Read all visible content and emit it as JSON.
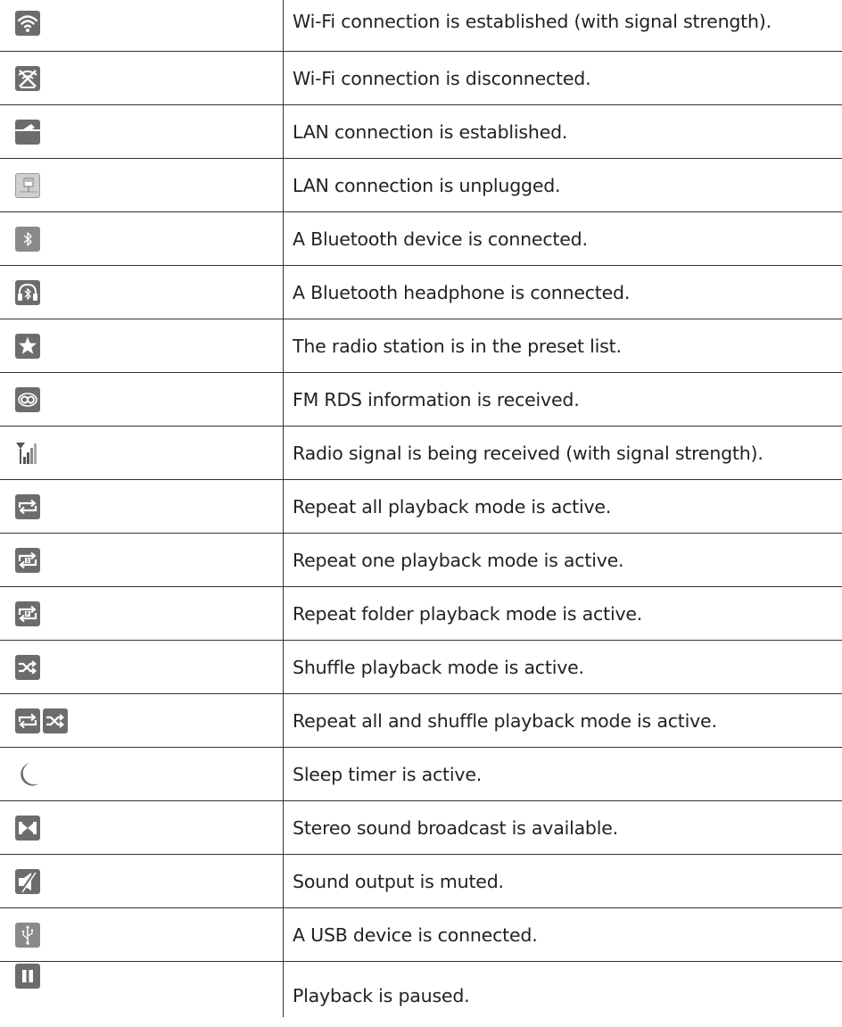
{
  "rows": [
    {
      "icons": [
        "wifi-signal-icon"
      ],
      "text": "Wi-Fi connection is established (with signal strength)."
    },
    {
      "icons": [
        "wifi-disconnected-icon"
      ],
      "text": "Wi-Fi connection is disconnected."
    },
    {
      "icons": [
        "lan-connected-icon"
      ],
      "text": "LAN connection is established."
    },
    {
      "icons": [
        "lan-unplugged-icon"
      ],
      "text": "LAN connection is unplugged."
    },
    {
      "icons": [
        "bluetooth-icon"
      ],
      "text": "A Bluetooth device is connected."
    },
    {
      "icons": [
        "bluetooth-headphone-icon"
      ],
      "text": "A Bluetooth headphone is connected."
    },
    {
      "icons": [
        "star-icon"
      ],
      "text": "The radio station is in the preset list."
    },
    {
      "icons": [
        "rds-icon"
      ],
      "text": "FM RDS information is received."
    },
    {
      "icons": [
        "radio-signal-icon"
      ],
      "text": "Radio signal is being received (with signal strength)."
    },
    {
      "icons": [
        "repeat-all-icon"
      ],
      "text": "Repeat all playback mode is active."
    },
    {
      "icons": [
        "repeat-one-icon"
      ],
      "text": "Repeat one playback mode is active."
    },
    {
      "icons": [
        "repeat-folder-icon"
      ],
      "text": "Repeat folder playback mode is active."
    },
    {
      "icons": [
        "shuffle-icon"
      ],
      "text": "Shuffle playback mode is active."
    },
    {
      "icons": [
        "repeat-all-icon",
        "shuffle-icon"
      ],
      "text": "Repeat all and shuffle playback mode is active."
    },
    {
      "icons": [
        "moon-icon"
      ],
      "text": "Sleep timer is active."
    },
    {
      "icons": [
        "stereo-icon"
      ],
      "text": "Stereo sound broadcast is available."
    },
    {
      "icons": [
        "mute-icon"
      ],
      "text": "Sound output is muted."
    },
    {
      "icons": [
        "usb-icon"
      ],
      "text": "A USB device is connected."
    },
    {
      "icons": [
        "pause-icon"
      ],
      "text": "Playback is paused."
    }
  ],
  "icon_colors": {
    "dark": "#6c6c6c",
    "light": "#cfcfcf",
    "glyph": "#ffffff"
  }
}
